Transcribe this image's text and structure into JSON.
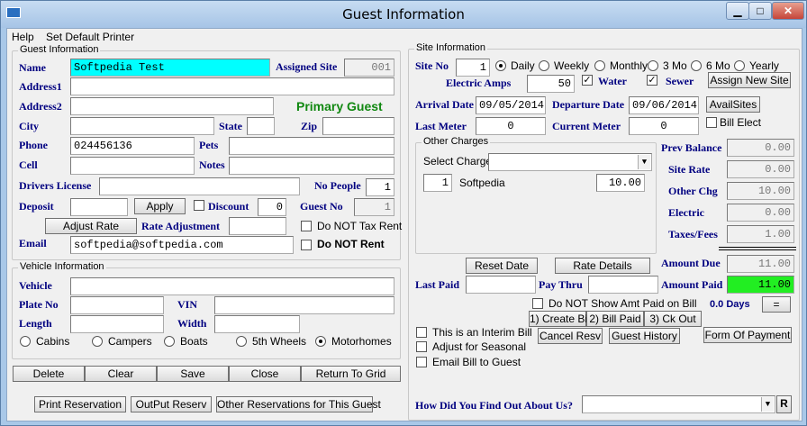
{
  "window": {
    "title": "Guest Information"
  },
  "menu": {
    "help": "Help",
    "set_default_printer": "Set Default Printer"
  },
  "guest": {
    "group_label": "Guest Information",
    "name_label": "Name",
    "name_value": "Softpedia Test",
    "assigned_site_label": "Assigned Site",
    "assigned_site_value": "001",
    "address1_label": "Address1",
    "address2_label": "Address2",
    "primary_guest": "Primary Guest",
    "city_label": "City",
    "state_label": "State",
    "zip_label": "Zip",
    "phone_label": "Phone",
    "phone_value": "024456136",
    "pets_label": "Pets",
    "cell_label": "Cell",
    "notes_label": "Notes",
    "drivers_license_label": "Drivers License",
    "no_people_label": "No People",
    "no_people_value": "1",
    "deposit_label": "Deposit",
    "apply_button": "Apply",
    "discount_label": "Discount",
    "discount_value": "0",
    "guest_no_label": "Guest No",
    "guest_no_value": "1",
    "adjust_rate_button": "Adjust Rate",
    "rate_adjustment_label": "Rate Adjustment",
    "do_not_tax_rent": "Do NOT Tax Rent",
    "email_label": "Email",
    "email_value": "softpedia@softpedia.com",
    "do_not_rent": "Do NOT Rent"
  },
  "vehicle": {
    "group_label": "Vehicle Information",
    "vehicle_label": "Vehicle",
    "plate_label": "Plate No",
    "vin_label": "VIN",
    "length_label": "Length",
    "width_label": "Width",
    "types": [
      "Cabins",
      "Campers",
      "Boats",
      "5th Wheels",
      "Motorhomes"
    ]
  },
  "bottom_buttons": {
    "delete": "Delete",
    "clear": "Clear",
    "save": "Save",
    "close": "Close",
    "return_to_grid": "Return To Grid",
    "print_reservation": "Print Reservation",
    "output_reserv": "OutPut Reserv",
    "other_reservations": "Other Reservations for This Guest"
  },
  "site": {
    "group_label": "Site Information",
    "site_no_label": "Site No",
    "site_no_value": "1",
    "periods": [
      "Daily",
      "Weekly",
      "Monthly",
      "3 Mo",
      "6 Mo",
      "Yearly"
    ],
    "electric_amps_label": "Electric Amps",
    "electric_amps_value": "50",
    "water_label": "Water",
    "sewer_label": "Sewer",
    "assign_new_site": "Assign New Site",
    "arrival_label": "Arrival Date",
    "arrival_value": "09/05/2014",
    "departure_label": "Departure Date",
    "departure_value": "09/06/2014",
    "avail_sites": "AvailSites",
    "last_meter_label": "Last Meter",
    "last_meter_value": "0",
    "current_meter_label": "Current Meter",
    "current_meter_value": "0",
    "bill_elect": "Bill Elect"
  },
  "charges": {
    "group_label": "Other Charges",
    "select_label": "Select Charge",
    "qty": "1",
    "item": "Softpedia",
    "amount": "10.00"
  },
  "totals": {
    "prev_balance_label": "Prev Balance",
    "prev_balance": "0.00",
    "site_rate_label": "Site Rate",
    "site_rate": "0.00",
    "other_chg_label": "Other Chg",
    "other_chg": "10.00",
    "electric_label": "Electric",
    "electric": "0.00",
    "taxes_label": "Taxes/Fees",
    "taxes": "1.00",
    "amount_due_label": "Amount Due",
    "amount_due": "11.00",
    "amount_paid_label": "Amount Paid",
    "amount_paid": "11.00",
    "days": "0.0 Days",
    "eq": "="
  },
  "payment": {
    "reset_date": "Reset Date",
    "rate_details": "Rate Details",
    "last_paid_label": "Last Paid",
    "pay_thru_label": "Pay Thru",
    "dont_show_amt": "Do NOT Show Amt Paid on Bill",
    "interim_bill": "This is an Interim Bill",
    "adjust_seasonal": "Adjust for Seasonal",
    "email_bill": "Email Bill to Guest",
    "create_bill": "1) Create Bill",
    "bill_paid": "2) Bill Paid",
    "ck_out": "3) Ck Out",
    "cancel_resv": "Cancel Resv",
    "guest_history": "Guest History",
    "form_of_payment": "Form Of Payment",
    "how_find_label": "How Did You Find Out About Us?",
    "r_button": "R"
  }
}
